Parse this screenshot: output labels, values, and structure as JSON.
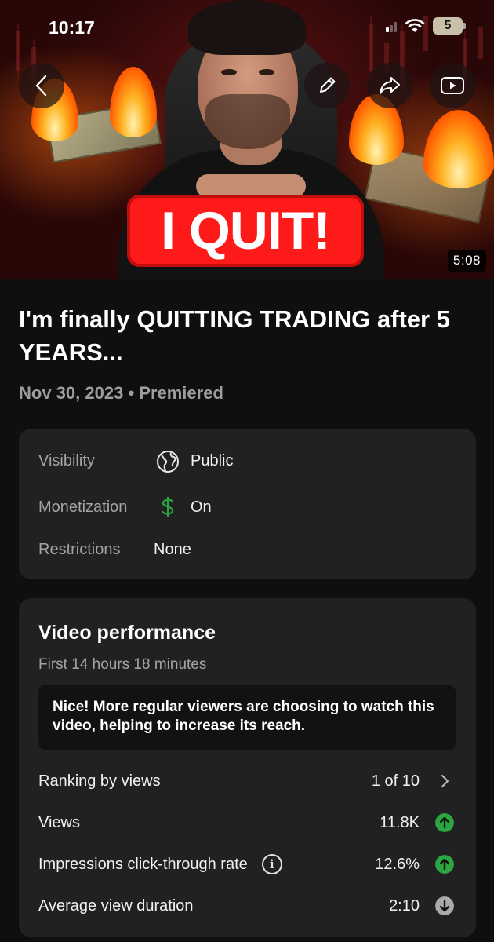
{
  "status_bar": {
    "time": "10:17",
    "battery": "5"
  },
  "thumbnail": {
    "overlay_text": "I QUIT!",
    "duration": "5:08"
  },
  "video": {
    "title": "I'm finally QUITTING TRADING after 5 YEARS...",
    "date": "Nov 30, 2023",
    "separator": "•",
    "status": "Premiered"
  },
  "details": {
    "visibility_label": "Visibility",
    "visibility_value": "Public",
    "monetization_label": "Monetization",
    "monetization_value": "On",
    "restrictions_label": "Restrictions",
    "restrictions_value": "None"
  },
  "performance": {
    "title": "Video performance",
    "subtitle": "First 14 hours 18 minutes",
    "tip": "Nice! More regular viewers are choosing to watch this video, helping to increase its reach.",
    "rows": [
      {
        "label": "Ranking by views",
        "value": "1 of 10",
        "indicator": "chevron-right"
      },
      {
        "label": "Views",
        "value": "11.8K",
        "indicator": "up",
        "color": "#2ba640"
      },
      {
        "label": "Impressions click-through rate",
        "value": "12.6%",
        "indicator": "up",
        "color": "#2ba640"
      },
      {
        "label": "Average view duration",
        "value": "2:10",
        "indicator": "down",
        "color": "#aaaaaa"
      }
    ]
  },
  "colors": {
    "accent_green": "#2ba640",
    "thumbnail_red": "#ff1a1a",
    "card_bg": "#212121"
  }
}
